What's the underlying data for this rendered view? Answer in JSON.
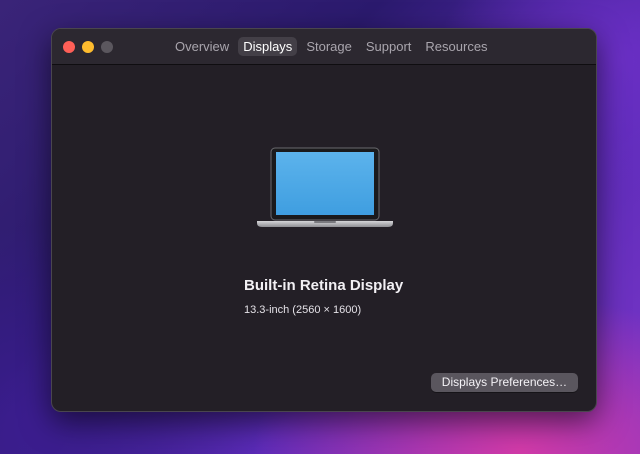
{
  "window": {
    "tabs": [
      {
        "label": "Overview"
      },
      {
        "label": "Displays"
      },
      {
        "label": "Storage"
      },
      {
        "label": "Support"
      },
      {
        "label": "Resources"
      }
    ],
    "active_tab": "Displays"
  },
  "display": {
    "icon": "laptop-icon",
    "name": "Built-in Retina Display",
    "size": "13.3-inch (2560 × 1600)"
  },
  "actions": {
    "preferences_label": "Displays Preferences…"
  },
  "colors": {
    "window_bg": "#231f26",
    "active_tab_bg": "#433f47",
    "close": "#fe5f57",
    "minimize": "#febc2e",
    "zoom_disabled": "#5b575e"
  }
}
